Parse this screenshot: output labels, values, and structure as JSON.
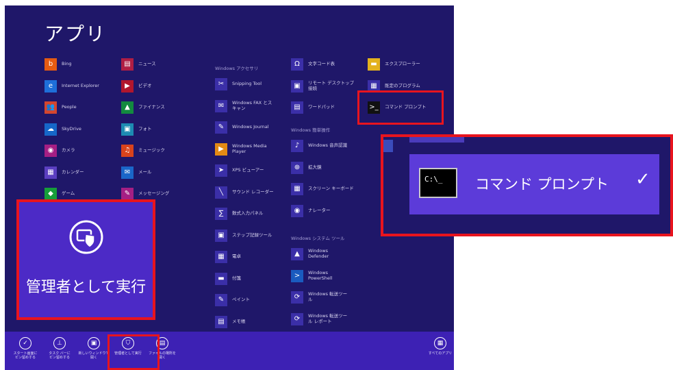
{
  "screen": {
    "title": "アプリ"
  },
  "columns": [
    {
      "apps": [
        {
          "label": "Bing",
          "icon": "bing-icon",
          "glyph": "b",
          "color": "#e55b12"
        },
        {
          "label": "Internet Explorer",
          "icon": "ie-icon",
          "glyph": "e",
          "color": "#1e6fd9"
        },
        {
          "label": "People",
          "icon": "people-icon",
          "glyph": "👥",
          "color": "#d3462f"
        },
        {
          "label": "SkyDrive",
          "icon": "skydrive-icon",
          "glyph": "☁",
          "color": "#1667c8"
        },
        {
          "label": "カメラ",
          "icon": "camera-icon",
          "glyph": "◉",
          "color": "#a51f84"
        },
        {
          "label": "カレンダー",
          "icon": "calendar-icon",
          "glyph": "▦",
          "color": "#5b3fc1"
        },
        {
          "label": "ゲーム",
          "icon": "games-icon",
          "glyph": "◆",
          "color": "#169e3a"
        }
      ]
    },
    {
      "apps": [
        {
          "label": "ニュース",
          "icon": "news-icon",
          "glyph": "▤",
          "color": "#b01e44"
        },
        {
          "label": "ビデオ",
          "icon": "video-icon",
          "glyph": "▶",
          "color": "#b1162d"
        },
        {
          "label": "ファイナンス",
          "icon": "finance-icon",
          "glyph": "▲",
          "color": "#138a3f"
        },
        {
          "label": "フォト",
          "icon": "photos-icon",
          "glyph": "▣",
          "color": "#1d8bb2"
        },
        {
          "label": "ミュージック",
          "icon": "music-icon",
          "glyph": "♫",
          "color": "#d9431c"
        },
        {
          "label": "メール",
          "icon": "mail-icon",
          "glyph": "✉",
          "color": "#1a66c9"
        },
        {
          "label": "メッセージング",
          "icon": "messaging-icon",
          "glyph": "✎",
          "color": "#a51f84"
        }
      ]
    },
    {
      "header": "Windows アクセサリ",
      "apps": [
        {
          "label": "Snipping Tool",
          "icon": "snipping-tool-icon",
          "glyph": "✂",
          "color": "#3b2fa8"
        },
        {
          "label": "Windows FAX とス\nキャン",
          "icon": "fax-icon",
          "glyph": "✉",
          "color": "#3b2fa8"
        },
        {
          "label": "Windows Journal",
          "icon": "journal-icon",
          "glyph": "✎",
          "color": "#3b2fa8"
        },
        {
          "label": "Windows Media\nPlayer",
          "icon": "media-player-icon",
          "glyph": "▶",
          "color": "#e38a14"
        },
        {
          "label": "XPS ビューアー",
          "icon": "xps-viewer-icon",
          "glyph": "➤",
          "color": "#3b2fa8"
        },
        {
          "label": "サウンド レコーダー",
          "icon": "sound-recorder-icon",
          "glyph": "╲",
          "color": "#3b2fa8"
        },
        {
          "label": "数式入力パネル",
          "icon": "math-input-icon",
          "glyph": "∑",
          "color": "#3b2fa8"
        },
        {
          "label": "ステップ記録ツール",
          "icon": "steps-recorder-icon",
          "glyph": "▣",
          "color": "#3b2fa8"
        },
        {
          "label": "電卓",
          "icon": "calculator-icon",
          "glyph": "▦",
          "color": "#3b2fa8"
        },
        {
          "label": "付箋",
          "icon": "sticky-notes-icon",
          "glyph": "▬",
          "color": "#3b2fa8"
        },
        {
          "label": "ペイント",
          "icon": "paint-icon",
          "glyph": "✎",
          "color": "#3b2fa8"
        },
        {
          "label": "メモ帳",
          "icon": "notepad-icon",
          "glyph": "▤",
          "color": "#3b2fa8"
        }
      ]
    },
    {
      "apps": [
        {
          "label": "文字コード表",
          "icon": "charmap-icon",
          "glyph": "Ω",
          "color": "#3b2fa8"
        },
        {
          "label": "リモート デスクトップ\n接続",
          "icon": "remote-desktop-icon",
          "glyph": "▣",
          "color": "#3b2fa8"
        },
        {
          "label": "ワードパッド",
          "icon": "wordpad-icon",
          "glyph": "▤",
          "color": "#3b2fa8"
        }
      ],
      "header2": "Windows 簡単操作",
      "apps2": [
        {
          "label": "Windows 音声認識",
          "icon": "speech-recognition-icon",
          "glyph": "♪",
          "color": "#3b2fa8"
        },
        {
          "label": "拡大鏡",
          "icon": "magnifier-icon",
          "glyph": "⊕",
          "color": "#3b2fa8"
        },
        {
          "label": "スクリーン キーボード",
          "icon": "on-screen-keyboard-icon",
          "glyph": "▦",
          "color": "#3b2fa8"
        },
        {
          "label": "ナレーター",
          "icon": "narrator-icon",
          "glyph": "◉",
          "color": "#3b2fa8"
        }
      ],
      "header3": "Windows システム ツール",
      "apps3": [
        {
          "label": "Windows\nDefender",
          "icon": "defender-icon",
          "glyph": "▲",
          "color": "#3b2fa8"
        },
        {
          "label": "Windows\nPowerShell",
          "icon": "powershell-icon",
          "glyph": ">",
          "color": "#1a5bbf"
        },
        {
          "label": "Windows 転送ツー\nル",
          "icon": "transfer-tool-icon",
          "glyph": "⟳",
          "color": "#3b2fa8"
        },
        {
          "label": "Windows 転送ツー\nル レポート",
          "icon": "transfer-report-icon",
          "glyph": "⟳",
          "color": "#3b2fa8"
        }
      ]
    },
    {
      "apps": [
        {
          "label": "エクスプローラー",
          "icon": "explorer-icon",
          "glyph": "▬",
          "color": "#e3b21d"
        },
        {
          "label": "既定のプログラム",
          "icon": "default-programs-icon",
          "glyph": "▦",
          "color": "#3b2fa8"
        },
        {
          "label": "コマンド プロンプト",
          "icon": "command-prompt-icon",
          "glyph": ">_",
          "color": "#111111"
        }
      ]
    }
  ],
  "appbar": {
    "commands": [
      {
        "label": "スタート画面に\nピン留めする",
        "icon": "pin-start-icon",
        "glyph": "✓"
      },
      {
        "label": "タスク バーに\nピン留めする",
        "icon": "pin-taskbar-icon",
        "glyph": "⊥"
      },
      {
        "label": "新しいウィンドウで\n開く",
        "icon": "new-window-icon",
        "glyph": "▣"
      },
      {
        "label": "管理者として実行",
        "icon": "run-as-admin-icon",
        "glyph": "⛉"
      },
      {
        "label": "ファイルの場所を\n開く",
        "icon": "open-file-location-icon",
        "glyph": "▤"
      }
    ],
    "all_apps": {
      "label": "すべてのアプリ",
      "icon": "all-apps-icon",
      "glyph": "▦"
    }
  },
  "callout_left": {
    "text": "管理者として実行",
    "icon": "run-as-admin-icon"
  },
  "callout_right": {
    "name": "コマンド プロンプト",
    "term_text": "C:\\_",
    "check": "✓"
  },
  "colors": {
    "background": "#1f1769",
    "appbar": "#3d21b4",
    "highlight": "#e8141e",
    "selection": "#5c3bd9"
  }
}
